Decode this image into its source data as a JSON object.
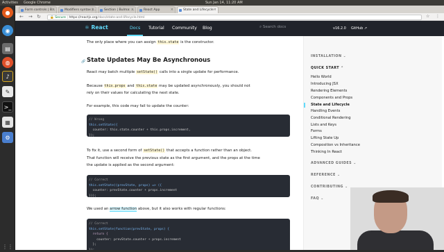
{
  "system": {
    "activities": "Activities",
    "app_name": "Google Chrome",
    "datetime": "Sun Jan 14, 11:20 AM"
  },
  "tabs": [
    {
      "label": "Form controls | B..."
    },
    {
      "label": "Modifiers syntax |..."
    },
    {
      "label": "Section | Bulma: ..."
    },
    {
      "label": "React App"
    },
    {
      "label": "State and Lifecycle",
      "active": true
    }
  ],
  "address": {
    "secure": "Secure",
    "host": "https://reactjs.org",
    "path": "/docs/state-and-lifecycle.html"
  },
  "react_nav": {
    "logo": "React",
    "links": [
      "Docs",
      "Tutorial",
      "Community",
      "Blog"
    ],
    "search_placeholder": "Search docs",
    "version": "v16.2.0",
    "github": "GitHub"
  },
  "article": {
    "p0_a": "The only place where you can assign ",
    "p0_code": "this.state",
    "p0_b": " is the constructor.",
    "heading": "State Updates May Be Asynchronous",
    "p1_a": "React may batch multiple ",
    "p1_code": "setState()",
    "p1_b": " calls into a single update for performance.",
    "p2_a": "Because ",
    "p2_code1": "this.props",
    "p2_and": " and ",
    "p2_code2": "this.state",
    "p2_b": " may be updated asynchronously, you should not",
    "p2_c": "rely on their values for calculating the next state.",
    "p3": "For example, this code may fail to update the counter:",
    "code1_c": "// Wrong",
    "code1_l1": "this.setState({",
    "code1_l2": "  counter: this.state.counter + this.props.increment,",
    "code1_l3": "});",
    "p4_a": "To fix it, use a second form of ",
    "p4_code": "setState()",
    "p4_b": " that accepts a function rather than an object.",
    "p4_c": "That function will receive the previous state as the first argument, and the props at the time",
    "p4_d": "the update is applied as the second argument:",
    "code2_c": "// Correct",
    "code2_l1": "this.setState((prevState, props) => ({",
    "code2_l2": "  counter: prevState.counter + props.increment",
    "code2_l3": "}));",
    "p5_a": "We used an ",
    "p5_link": "arrow function",
    "p5_b": " above, but it also works with regular functions:",
    "code3_c": "// Correct",
    "code3_l1": "this.setState(function(prevState, props) {",
    "code3_l2": "  return {",
    "code3_l3": "    counter: prevState.counter + props.increment",
    "code3_l4": "  };",
    "code3_l5": "});"
  },
  "sidebar": {
    "installation": "INSTALLATION",
    "quick_start": "QUICK START",
    "items": [
      "Hello World",
      "Introducing JSX",
      "Rendering Elements",
      "Components and Props",
      "State and Lifecycle",
      "Handling Events",
      "Conditional Rendering",
      "Lists and Keys",
      "Forms",
      "Lifting State Up",
      "Composition vs Inheritance",
      "Thinking In React"
    ],
    "active_index": 4,
    "advanced": "ADVANCED GUIDES",
    "reference": "REFERENCE",
    "contributing": "CONTRIBUTING",
    "faq": "FAQ"
  },
  "colors": {
    "react_blue": "#61dafb",
    "nav_bg": "#20232a",
    "code_bg": "#282c34"
  }
}
